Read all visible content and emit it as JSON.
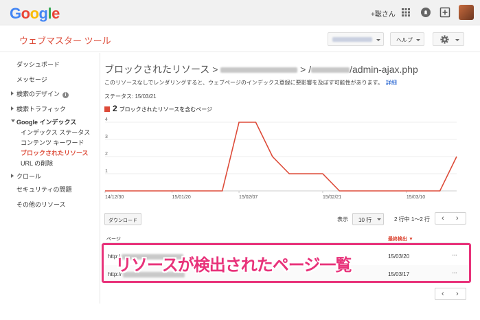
{
  "topbar": {
    "logo": [
      "G",
      "o",
      "o",
      "g",
      "l",
      "e"
    ],
    "logo_colors": [
      "#4285f4",
      "#ea4335",
      "#fbbc05",
      "#4285f4",
      "#34a853",
      "#ea4335"
    ],
    "user": "+聡さん"
  },
  "product": {
    "title": "ウェブマスター ツール",
    "help_label": "ヘルプ"
  },
  "sidebar": {
    "items": [
      {
        "label": "ダッシュボード"
      },
      {
        "label": "メッセージ"
      },
      {
        "label": "検索のデザイン"
      },
      {
        "label": "検索トラフィック"
      },
      {
        "label": "Google インデックス"
      },
      {
        "label": "インデックス ステータス"
      },
      {
        "label": "コンテンツ キーワード"
      },
      {
        "label": "ブロックされたリソース"
      },
      {
        "label": "URL の削除"
      },
      {
        "label": "クロール"
      },
      {
        "label": "セキュリティの問題"
      },
      {
        "label": "その他のリソース"
      }
    ]
  },
  "main": {
    "heading_prefix": "ブロックされたリソース > ",
    "heading_sep": " > /",
    "heading_suffix": "/admin-ajax.php",
    "description": "このリソースなしでレンダリングすると、ウェブページのインデックス登録に悪影響を及ぼす可能性があります。",
    "detail_link": "詳細",
    "status": "ステータス: 15/03/21",
    "legend_count": "2",
    "legend_label": "ブロックされたリソースを含むページ",
    "download_label": "ダウンロード",
    "show_label": "表示",
    "rows_value": "10 行",
    "pagination": "2 行中 1〜2 行",
    "col_page": "ページ",
    "col_detected": "最終検出 ▼",
    "rows": [
      {
        "url_prefix": "http:/",
        "date": "15/03/20",
        "more": "···"
      },
      {
        "url_prefix": "http://",
        "date": "15/03/17",
        "more": "···"
      }
    ],
    "annotation": "リソースが検出されたページ一覧"
  },
  "chart_data": {
    "type": "line",
    "x": [
      "14/12/30",
      "15/01/05",
      "15/01/10",
      "15/01/15",
      "15/01/20",
      "15/01/25",
      "15/01/30",
      "15/02/04",
      "15/02/07",
      "15/02/10",
      "15/02/13",
      "15/02/16",
      "15/02/19",
      "15/02/21",
      "15/02/24",
      "15/02/27",
      "15/03/02",
      "15/03/06",
      "15/03/10",
      "15/03/14",
      "15/03/18",
      "15/03/21"
    ],
    "values": [
      0,
      0,
      0,
      0,
      0,
      0,
      0,
      0,
      4,
      4,
      2,
      1,
      1,
      1,
      0,
      0,
      0,
      0,
      0,
      0,
      0,
      2
    ],
    "tick_labels": [
      "14/12/30",
      "15/01/20",
      "15/02/07",
      "15/02/21",
      "15/03/10"
    ],
    "tick_index": [
      0,
      4,
      8,
      13,
      18
    ],
    "y_ticks": [
      "1",
      "2",
      "3",
      "4"
    ],
    "ylim": [
      0,
      4
    ],
    "grid": true,
    "line_color": "#dd4b39"
  }
}
